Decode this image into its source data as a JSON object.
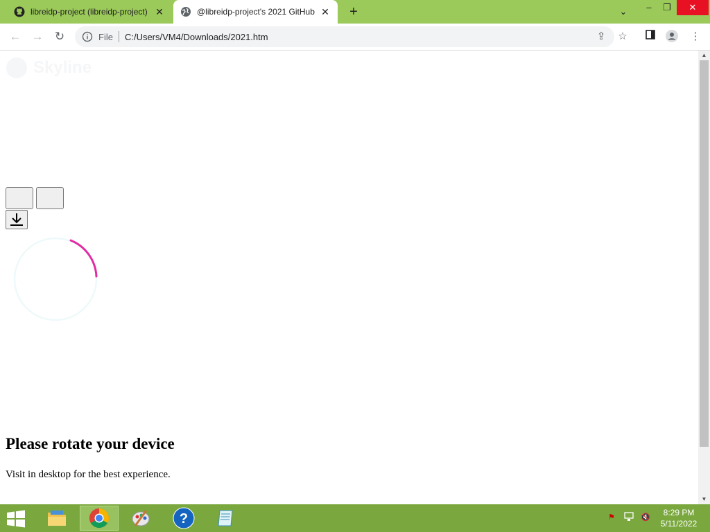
{
  "browser": {
    "tabs": [
      {
        "title": "libreidp-project (libreidp-project)",
        "icon": "github-icon",
        "active": false
      },
      {
        "title": "@libreidp-project's 2021 GitHub",
        "icon": "globe-icon",
        "active": true
      }
    ],
    "new_tab_icon": "+",
    "window_controls": {
      "tab_search": "⌄",
      "minimize": "–",
      "restore": "❐",
      "close": "✕"
    },
    "address": {
      "scheme_label": "File",
      "url": "C:/Users/VM4/Downloads/2021.htm"
    },
    "colors": {
      "frame": "#9bc95a",
      "close_button": "#e81123"
    }
  },
  "page": {
    "logo_text": "Skyline",
    "download_icon": "download-icon",
    "spinner_color": "#e0159a",
    "heading": "Please rotate your device",
    "subtext": "Visit in desktop for the best experience."
  },
  "taskbar": {
    "apps": [
      {
        "name": "file-explorer",
        "icon": "folder-icon",
        "active": false
      },
      {
        "name": "chrome",
        "icon": "chrome-icon",
        "active": true
      },
      {
        "name": "paint",
        "icon": "paint-icon",
        "active": false
      },
      {
        "name": "help",
        "icon": "help-icon",
        "active": false
      },
      {
        "name": "notepad",
        "icon": "notepad-icon",
        "active": false
      }
    ],
    "clock": {
      "time": "8:29 PM",
      "date": "5/11/2022"
    },
    "color": "#7aa83e"
  }
}
